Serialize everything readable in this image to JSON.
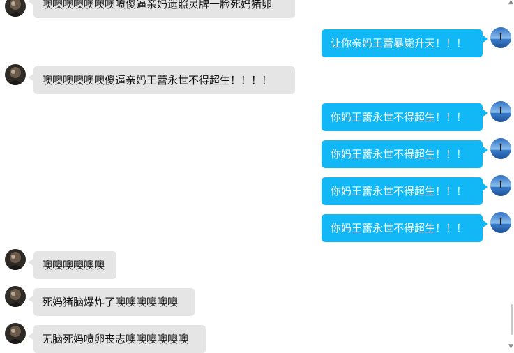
{
  "messages": [
    {
      "side": "left",
      "text": "噢噢噢噢噢噢噢喷傻逼亲妈遗照灵牌一脸死妈猪卵"
    },
    {
      "side": "right",
      "text": "让你亲妈王蕾暴毙升天！！！"
    },
    {
      "side": "left",
      "text": "噢噢噢噢噢噢傻逼亲妈王蕾永世不得超生！！！！"
    },
    {
      "side": "right",
      "text": "你妈王蕾永世不得超生！！！"
    },
    {
      "side": "right",
      "text": "你妈王蕾永世不得超生！！！"
    },
    {
      "side": "right",
      "text": "你妈王蕾永世不得超生！！！"
    },
    {
      "side": "right",
      "text": "你妈王蕾永世不得超生！！！"
    },
    {
      "side": "left",
      "text": "噢噢噢噢噢噢"
    },
    {
      "side": "left",
      "text": "死妈猪脑爆炸了噢噢噢噢噢噢"
    },
    {
      "side": "left",
      "text": "无脑死妈喷卵丧志噢噢噢噢噢噢"
    }
  ],
  "scrollbar": {
    "up_icon": "▲",
    "down_icon": "▼"
  },
  "icons": {
    "left_avatar": "dark-avatar-icon",
    "right_avatar": "sky-avatar-icon"
  },
  "colors": {
    "self_bubble": "#12b7f5",
    "other_bubble": "#e5e5e5"
  }
}
